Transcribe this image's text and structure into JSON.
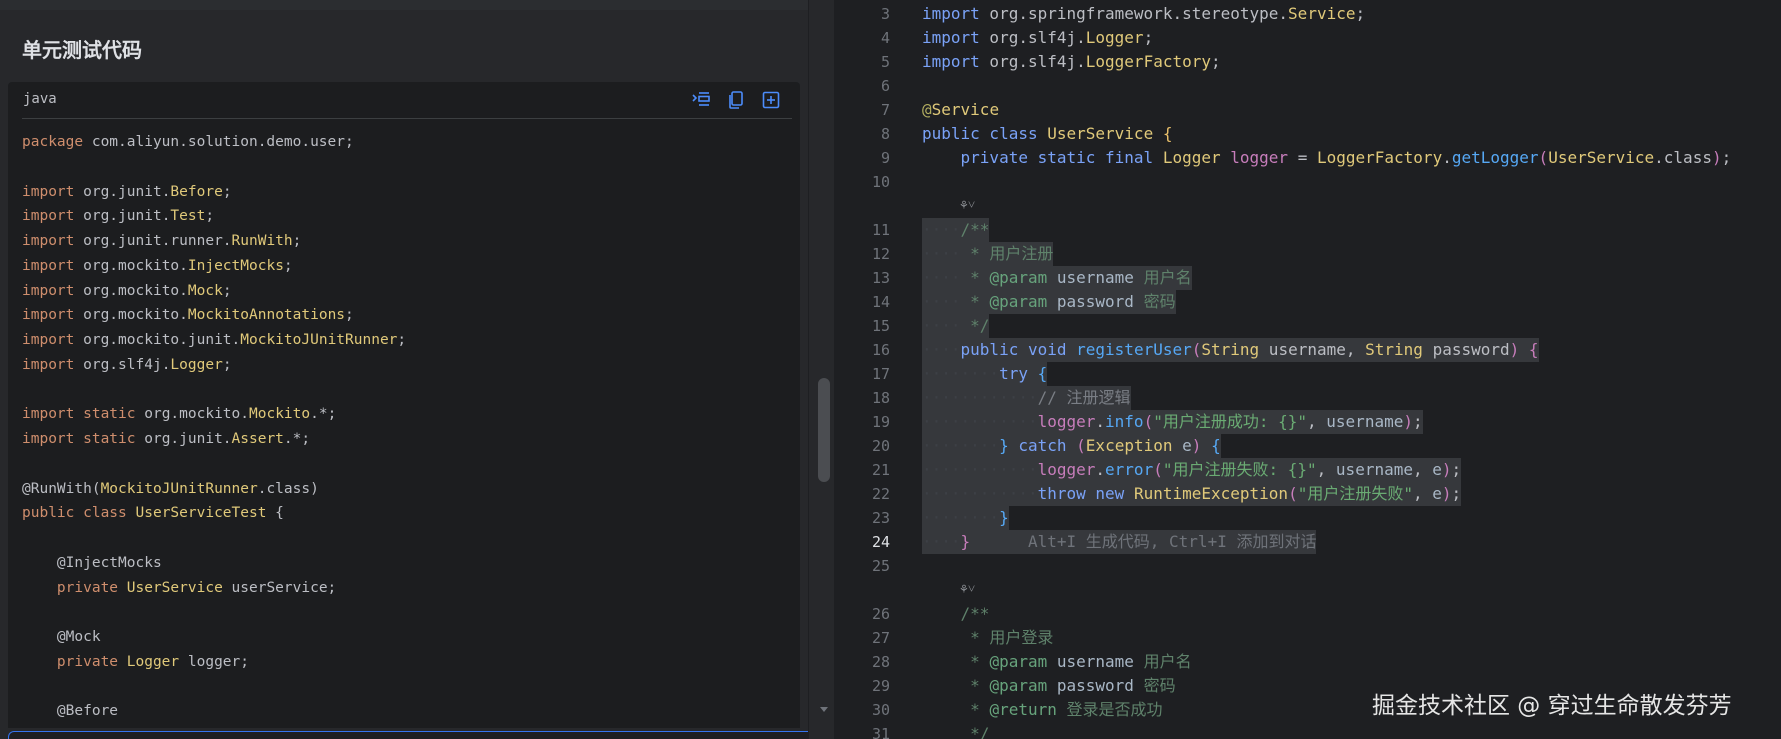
{
  "left_panel": {
    "section_title": "单元测试代码",
    "code_language": "java",
    "toolbar_icons": [
      "insert-code-icon",
      "copy-icon",
      "new-file-icon"
    ],
    "code_lines": [
      [
        [
          "kw",
          "package"
        ],
        [
          "",
          " com.aliyun.solution.demo.user;"
        ]
      ],
      [],
      [
        [
          "kw",
          "import"
        ],
        [
          "",
          " org.junit."
        ],
        [
          "cls",
          "Before"
        ],
        [
          "",
          ";"
        ]
      ],
      [
        [
          "kw",
          "import"
        ],
        [
          "",
          " org.junit."
        ],
        [
          "cls",
          "Test"
        ],
        [
          "",
          ";"
        ]
      ],
      [
        [
          "kw",
          "import"
        ],
        [
          "",
          " org.junit.runner."
        ],
        [
          "cls",
          "RunWith"
        ],
        [
          "",
          ";"
        ]
      ],
      [
        [
          "kw",
          "import"
        ],
        [
          "",
          " org.mockito."
        ],
        [
          "cls",
          "InjectMocks"
        ],
        [
          "",
          ";"
        ]
      ],
      [
        [
          "kw",
          "import"
        ],
        [
          "",
          " org.mockito."
        ],
        [
          "cls",
          "Mock"
        ],
        [
          "",
          ";"
        ]
      ],
      [
        [
          "kw",
          "import"
        ],
        [
          "",
          " org.mockito."
        ],
        [
          "cls",
          "MockitoAnnotations"
        ],
        [
          "",
          ";"
        ]
      ],
      [
        [
          "kw",
          "import"
        ],
        [
          "",
          " org.mockito.junit."
        ],
        [
          "cls",
          "MockitoJUnitRunner"
        ],
        [
          "",
          ";"
        ]
      ],
      [
        [
          "kw",
          "import"
        ],
        [
          "",
          " org.slf4j."
        ],
        [
          "cls",
          "Logger"
        ],
        [
          "",
          ";"
        ]
      ],
      [],
      [
        [
          "kw",
          "import static"
        ],
        [
          "",
          " org.mockito."
        ],
        [
          "cls",
          "Mockito"
        ],
        [
          "",
          ".*;"
        ]
      ],
      [
        [
          "kw",
          "import static"
        ],
        [
          "",
          " org.junit."
        ],
        [
          "cls",
          "Assert"
        ],
        [
          "",
          ".*;"
        ]
      ],
      [],
      [
        [
          "",
          "@RunWith("
        ],
        [
          "cls",
          "MockitoJUnitRunner"
        ],
        [
          "",
          ".class)"
        ]
      ],
      [
        [
          "kw",
          "public class"
        ],
        [
          "",
          " "
        ],
        [
          "cls",
          "UserServiceTest"
        ],
        [
          "",
          " {"
        ]
      ],
      [],
      [
        [
          "",
          "    @InjectMocks"
        ]
      ],
      [
        [
          "",
          "    "
        ],
        [
          "kw",
          "private"
        ],
        [
          "",
          " "
        ],
        [
          "cls",
          "UserService"
        ],
        [
          "",
          " userService;"
        ]
      ],
      [],
      [
        [
          "",
          "    @Mock"
        ]
      ],
      [
        [
          "",
          "    "
        ],
        [
          "kw",
          "private"
        ],
        [
          "",
          " "
        ],
        [
          "cls",
          "Logger"
        ],
        [
          "",
          " logger;"
        ]
      ],
      [],
      [
        [
          "",
          "    @Before"
        ]
      ]
    ]
  },
  "editor": {
    "lines": [
      {
        "n": "3",
        "parts": [
          [
            "kb",
            "import"
          ],
          [
            "",
            " org.springframework.stereotype."
          ],
          [
            "cls",
            "Service"
          ],
          [
            "",
            ";"
          ]
        ]
      },
      {
        "n": "4",
        "parts": [
          [
            "kb",
            "import"
          ],
          [
            "",
            " org.slf4j."
          ],
          [
            "cls",
            "Logger"
          ],
          [
            "",
            ";"
          ]
        ]
      },
      {
        "n": "5",
        "parts": [
          [
            "kb",
            "import"
          ],
          [
            "",
            " org.slf4j."
          ],
          [
            "cls",
            "LoggerFactory"
          ],
          [
            "",
            ";"
          ]
        ]
      },
      {
        "n": "6",
        "parts": []
      },
      {
        "n": "7",
        "parts": [
          [
            "ann",
            "@"
          ],
          [
            "cls",
            "Service"
          ]
        ]
      },
      {
        "n": "8",
        "parts": [
          [
            "kb",
            "public class"
          ],
          [
            "",
            " "
          ],
          [
            "cls",
            "UserService"
          ],
          [
            "",
            " "
          ],
          [
            "brace1",
            "{"
          ]
        ]
      },
      {
        "n": "9",
        "parts": [
          [
            "",
            "    "
          ],
          [
            "kb",
            "private static final"
          ],
          [
            "",
            " "
          ],
          [
            "cls",
            "Logger"
          ],
          [
            "",
            " "
          ],
          [
            "fld",
            "logger"
          ],
          [
            "",
            " = "
          ],
          [
            "cls",
            "LoggerFactory"
          ],
          [
            "",
            "."
          ],
          [
            "met",
            "getLogger"
          ],
          [
            "pur",
            "("
          ],
          [
            "cls",
            "UserService"
          ],
          [
            "",
            ".class"
          ],
          [
            "pur",
            ")"
          ],
          [
            "",
            ";"
          ]
        ]
      },
      {
        "n": "10",
        "parts": []
      },
      {
        "n": "11",
        "sel": true,
        "parts": [
          [
            "ind",
            "····"
          ],
          [
            "doc",
            "/**"
          ]
        ]
      },
      {
        "n": "12",
        "sel": true,
        "parts": [
          [
            "ind",
            "····"
          ],
          [
            "doc",
            " * 用户注册"
          ]
        ]
      },
      {
        "n": "13",
        "sel": true,
        "parts": [
          [
            "ind",
            "····"
          ],
          [
            "doc",
            " * "
          ],
          [
            "tag",
            "@param"
          ],
          [
            "",
            " "
          ],
          [
            "param",
            "username"
          ],
          [
            "doc",
            " 用户名"
          ]
        ]
      },
      {
        "n": "14",
        "sel": true,
        "parts": [
          [
            "ind",
            "····"
          ],
          [
            "doc",
            " * "
          ],
          [
            "tag",
            "@param"
          ],
          [
            "",
            " "
          ],
          [
            "param",
            "password"
          ],
          [
            "doc",
            " 密码"
          ]
        ]
      },
      {
        "n": "15",
        "sel": true,
        "parts": [
          [
            "ind",
            "····"
          ],
          [
            "doc",
            " */"
          ]
        ]
      },
      {
        "n": "16",
        "sel": true,
        "parts": [
          [
            "ind",
            "····"
          ],
          [
            "kb",
            "public void"
          ],
          [
            "",
            " "
          ],
          [
            "met",
            "registerUser"
          ],
          [
            "pur",
            "("
          ],
          [
            "cls",
            "String"
          ],
          [
            "",
            " username, "
          ],
          [
            "cls",
            "String"
          ],
          [
            "",
            " password"
          ],
          [
            "pur",
            ")"
          ],
          [
            "",
            " "
          ],
          [
            "brace2",
            "{"
          ]
        ]
      },
      {
        "n": "17",
        "sel": true,
        "parts": [
          [
            "ind",
            "········"
          ],
          [
            "kb",
            "try"
          ],
          [
            "",
            " "
          ],
          [
            "brace3",
            "{"
          ]
        ]
      },
      {
        "n": "18",
        "sel": true,
        "parts": [
          [
            "ind",
            "············"
          ],
          [
            "cmt",
            "// 注册逻辑"
          ]
        ]
      },
      {
        "n": "19",
        "sel": true,
        "parts": [
          [
            "ind",
            "············"
          ],
          [
            "fld",
            "logger"
          ],
          [
            "",
            "."
          ],
          [
            "met",
            "info"
          ],
          [
            "pur",
            "("
          ],
          [
            "str",
            "\"用户注册成功: {}\""
          ],
          [
            "",
            ", "
          ],
          [
            "param",
            "username"
          ],
          [
            "pur",
            ")"
          ],
          [
            "",
            ";"
          ]
        ]
      },
      {
        "n": "20",
        "sel": true,
        "parts": [
          [
            "ind",
            "········"
          ],
          [
            "brace3",
            "}"
          ],
          [
            "",
            " "
          ],
          [
            "kb",
            "catch"
          ],
          [
            "",
            " "
          ],
          [
            "pur",
            "("
          ],
          [
            "cls",
            "Exception"
          ],
          [
            "",
            " "
          ],
          [
            "param",
            "e"
          ],
          [
            "pur",
            ")"
          ],
          [
            "",
            " "
          ],
          [
            "brace3",
            "{"
          ]
        ]
      },
      {
        "n": "21",
        "sel": true,
        "parts": [
          [
            "ind",
            "············"
          ],
          [
            "fld",
            "logger"
          ],
          [
            "",
            "."
          ],
          [
            "met",
            "error"
          ],
          [
            "pur",
            "("
          ],
          [
            "str",
            "\"用户注册失败: {}\""
          ],
          [
            "",
            ", "
          ],
          [
            "param",
            "username"
          ],
          [
            "",
            ", "
          ],
          [
            "param",
            "e"
          ],
          [
            "pur",
            ")"
          ],
          [
            "",
            ";"
          ]
        ]
      },
      {
        "n": "22",
        "sel": true,
        "parts": [
          [
            "ind",
            "············"
          ],
          [
            "kb",
            "throw new"
          ],
          [
            "",
            " "
          ],
          [
            "cls",
            "RuntimeException"
          ],
          [
            "pur",
            "("
          ],
          [
            "str",
            "\"用户注册失败\""
          ],
          [
            "",
            ", "
          ],
          [
            "param",
            "e"
          ],
          [
            "pur",
            ")"
          ],
          [
            "",
            ";"
          ]
        ]
      },
      {
        "n": "23",
        "sel": true,
        "parts": [
          [
            "ind",
            "········"
          ],
          [
            "brace3",
            "}"
          ]
        ]
      },
      {
        "n": "24",
        "current": true,
        "sel": true,
        "parts": [
          [
            "ind",
            "····"
          ],
          [
            "brace2",
            "}"
          ]
        ],
        "hint": "Alt+I 生成代码, Ctrl+I 添加到对话"
      },
      {
        "n": "25",
        "parts": []
      },
      {
        "n": "26",
        "parts": [
          [
            "",
            "    "
          ],
          [
            "doc",
            "/**"
          ]
        ]
      },
      {
        "n": "27",
        "parts": [
          [
            "doc",
            "     * 用户登录"
          ]
        ]
      },
      {
        "n": "28",
        "parts": [
          [
            "doc",
            "     * "
          ],
          [
            "tag",
            "@param"
          ],
          [
            "",
            " "
          ],
          [
            "param",
            "username"
          ],
          [
            "doc",
            " 用户名"
          ]
        ]
      },
      {
        "n": "29",
        "parts": [
          [
            "doc",
            "     * "
          ],
          [
            "tag",
            "@param"
          ],
          [
            "",
            " "
          ],
          [
            "param",
            "password"
          ],
          [
            "doc",
            " 密码"
          ]
        ]
      },
      {
        "n": "30",
        "parts": [
          [
            "doc",
            "     * "
          ],
          [
            "tag",
            "@return"
          ],
          [
            "doc",
            " 登录是否成功"
          ]
        ]
      },
      {
        "n": "31",
        "parts": [
          [
            "doc",
            "     */"
          ]
        ]
      }
    ],
    "fold_glyph": "⚘˅"
  },
  "watermark": "掘金技术社区 @ 穿过生命散发芬芳",
  "colors": {
    "accent": "#3574f0",
    "editor_bg": "#1e1f22",
    "panel_bg": "#27282b"
  }
}
